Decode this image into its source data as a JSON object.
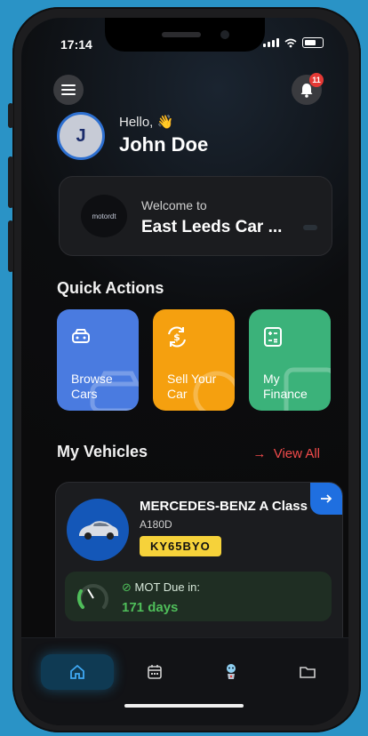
{
  "status_bar": {
    "time": "17:14"
  },
  "header": {
    "notification_count": "11"
  },
  "user": {
    "greeting": "Hello,",
    "wave_emoji": "👋",
    "name": "John Doe",
    "initial": "J"
  },
  "welcome": {
    "logo_text": "motordt",
    "label": "Welcome to",
    "dealer_name": "East Leeds Car ..."
  },
  "quick_actions": {
    "title": "Quick Actions",
    "items": [
      {
        "label_line1": "Browse",
        "label_line2": "Cars",
        "color": "#4a7be0",
        "icon": "car-icon"
      },
      {
        "label_line1": "Sell Your",
        "label_line2": "Car",
        "color": "#f5a00f",
        "icon": "sell-car-icon"
      },
      {
        "label_line1": "My",
        "label_line2": "Finance",
        "color": "#3bb27a",
        "icon": "calculator-icon"
      }
    ]
  },
  "vehicles": {
    "title": "My Vehicles",
    "view_all": "View All",
    "items": [
      {
        "make": "MERCEDES-BENZ A Class",
        "model": "A180D",
        "plate": "KY65BYO",
        "mot_label": "MOT Due in:",
        "mot_days": "171 days"
      }
    ]
  },
  "tabbar": {
    "items": [
      {
        "icon": "home-icon",
        "active": true
      },
      {
        "icon": "calendar-icon",
        "active": false
      },
      {
        "icon": "assistant-icon",
        "active": false
      },
      {
        "icon": "folder-icon",
        "active": false
      }
    ]
  },
  "colors": {
    "accent_blue": "#1f6fe0",
    "accent_red": "#f24b4b",
    "mot_green": "#4fbe5a",
    "plate_yellow": "#f6d23a"
  }
}
